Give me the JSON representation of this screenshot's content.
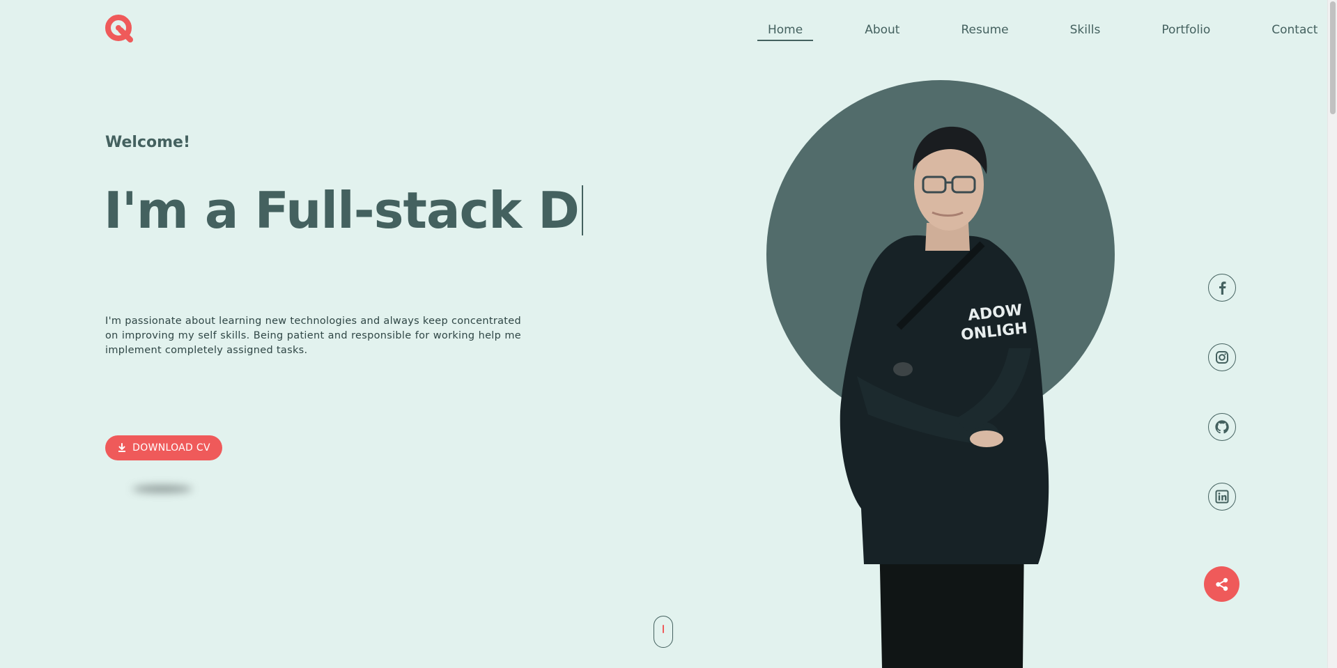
{
  "nav": {
    "items": [
      {
        "label": "Home",
        "active": true
      },
      {
        "label": "About"
      },
      {
        "label": "Resume"
      },
      {
        "label": "Skills"
      },
      {
        "label": "Portfolio"
      },
      {
        "label": "Contact"
      }
    ]
  },
  "hero": {
    "welcome": "Welcome!",
    "headline": "I'm a Full-stack D",
    "description": "I'm passionate about learning new technologies and always keep concentrated on improving my self skills. Being patient and responsible for working help me implement completely assigned tasks.",
    "cv_button_label": "DOWNLOAD CV"
  },
  "social": [
    {
      "icon": "facebook-icon"
    },
    {
      "icon": "instagram-icon"
    },
    {
      "icon": "github-icon"
    },
    {
      "icon": "linkedin-icon"
    }
  ],
  "colors": {
    "background": "#e2f2ee",
    "text": "#44615f",
    "accent": "#ef5a5a",
    "portrait_circle": "#526c6b"
  }
}
